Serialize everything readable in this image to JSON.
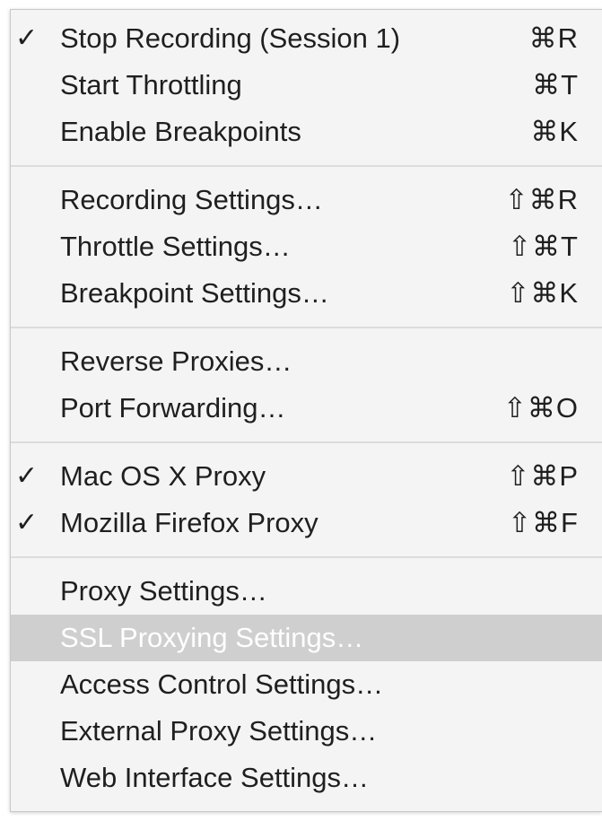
{
  "menu": {
    "groups": [
      {
        "items": [
          {
            "label": "Stop Recording (Session 1)",
            "shortcut": "⌘R",
            "checked": true,
            "disabled": false
          },
          {
            "label": "Start Throttling",
            "shortcut": "⌘T",
            "checked": false,
            "disabled": false
          },
          {
            "label": "Enable Breakpoints",
            "shortcut": "⌘K",
            "checked": false,
            "disabled": false
          }
        ]
      },
      {
        "items": [
          {
            "label": "Recording Settings…",
            "shortcut": "⇧⌘R",
            "checked": false,
            "disabled": false
          },
          {
            "label": "Throttle Settings…",
            "shortcut": "⇧⌘T",
            "checked": false,
            "disabled": false
          },
          {
            "label": "Breakpoint Settings…",
            "shortcut": "⇧⌘K",
            "checked": false,
            "disabled": false
          }
        ]
      },
      {
        "items": [
          {
            "label": "Reverse Proxies…",
            "shortcut": "",
            "checked": false,
            "disabled": false
          },
          {
            "label": "Port Forwarding…",
            "shortcut": "⇧⌘O",
            "checked": false,
            "disabled": false
          }
        ]
      },
      {
        "items": [
          {
            "label": "Mac OS X Proxy",
            "shortcut": "⇧⌘P",
            "checked": true,
            "disabled": false
          },
          {
            "label": "Mozilla Firefox Proxy",
            "shortcut": "⇧⌘F",
            "checked": true,
            "disabled": false
          }
        ]
      },
      {
        "items": [
          {
            "label": "Proxy Settings…",
            "shortcut": "",
            "checked": false,
            "disabled": false
          },
          {
            "label": "SSL Proxying Settings…",
            "shortcut": "",
            "checked": false,
            "disabled": true,
            "highlighted": true
          },
          {
            "label": "Access Control Settings…",
            "shortcut": "",
            "checked": false,
            "disabled": false
          },
          {
            "label": "External Proxy Settings…",
            "shortcut": "",
            "checked": false,
            "disabled": false
          },
          {
            "label": "Web Interface Settings…",
            "shortcut": "",
            "checked": false,
            "disabled": false
          }
        ]
      }
    ],
    "check_glyph": "✓",
    "icons": {
      "checkmark": "checkmark-icon"
    },
    "colors": {
      "background": "#f4f4f4",
      "text": "#1f1f1f",
      "highlight": "#cfcfcf",
      "separator": "#dcdcdc"
    }
  }
}
